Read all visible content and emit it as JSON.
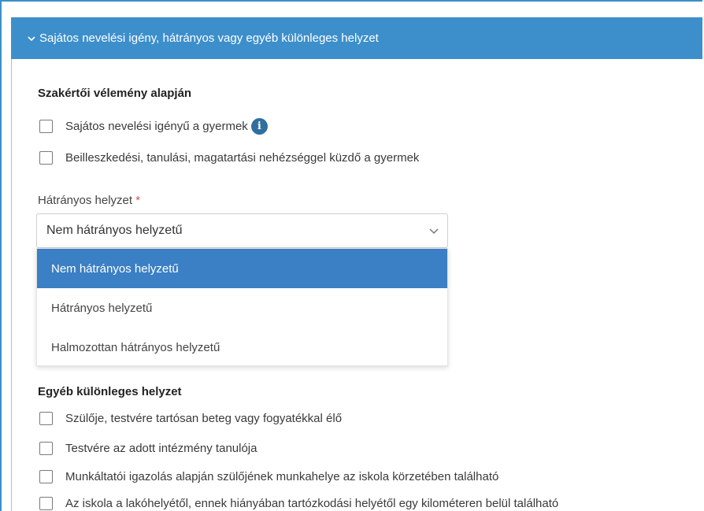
{
  "section": {
    "title": "Sajátos nevelési igény, hátrányos vagy egyéb különleges helyzet",
    "icon": "chevron-down-icon",
    "color": "#3d8fcc"
  },
  "expert_group": {
    "title": "Szakértői vélemény alapján",
    "items": [
      {
        "label": "Sajátos nevelési igényű a gyermek",
        "checked": false,
        "info_icon": "info-icon"
      },
      {
        "label": "Beilleszkedési, tanulási, magatartási nehézséggel küzdő a gyermek",
        "checked": false
      }
    ]
  },
  "disadvantage": {
    "label": "Hátrányos helyzet",
    "required_marker": "*",
    "selected_value": "Nem hátrányos helyzetű",
    "caret_icon": "chevron-down-icon",
    "options": [
      {
        "label": "Nem hátrányos helyzetű",
        "selected": true
      },
      {
        "label": "Hátrányos helyzetű",
        "selected": false
      },
      {
        "label": "Halmozottan hátrányos helyzetű",
        "selected": false
      }
    ],
    "highlight_color": "#3b7fc4"
  },
  "other_group": {
    "title": "Egyéb különleges helyzet",
    "items": [
      {
        "label": "Szülője, testvére tartósan beteg vagy fogyatékkal élő",
        "checked": false
      },
      {
        "label": "Testvére az adott intézmény tanulója",
        "checked": false
      },
      {
        "label": "Munkáltatói igazolás alapján szülőjének munkahelye az iskola körzetében található",
        "checked": false
      },
      {
        "label": "Az iskola a lakóhelyétől, ennek hiányában tartózkodási helyétől egy kilométeren belül található",
        "checked": false
      }
    ]
  }
}
